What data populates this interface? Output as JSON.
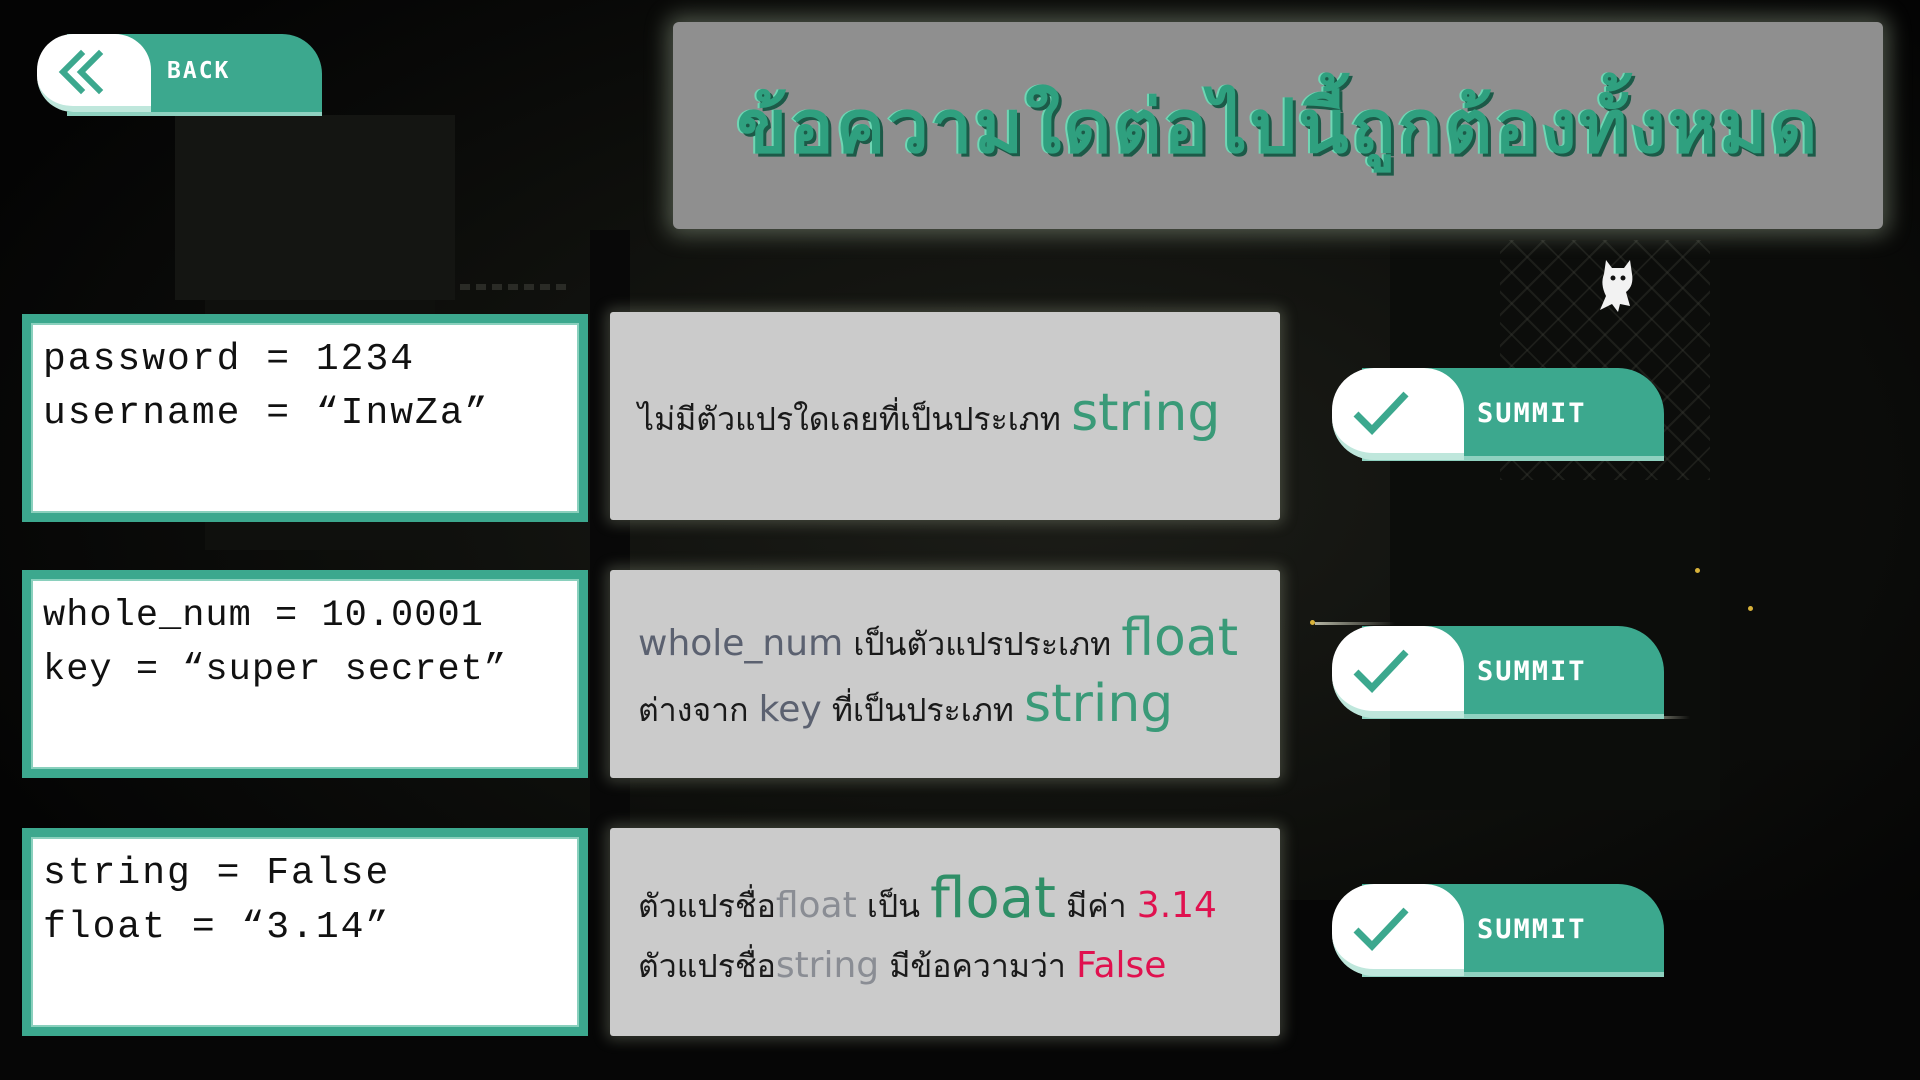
{
  "back_button": {
    "label": "BACK"
  },
  "title": "ข้อความใดต่อไปนี้ถูกต้องทั้งหมด",
  "questions": [
    {
      "code": [
        "password = 1234",
        "username = “InwZa”"
      ],
      "statement": {
        "line1": {
          "text": "ไม่มีตัวแปรใดเลยที่เป็นประเภท ",
          "type_word": "string"
        }
      },
      "submit_label": "SUMMIT"
    },
    {
      "code": [
        "whole_num = 10.0001",
        "key = “super secret”"
      ],
      "statement": {
        "line1": {
          "var": "whole_num",
          "text": " เป็นตัวแปรประเภท ",
          "type_word": "float"
        },
        "line2": {
          "text_a": "ต่างจาก ",
          "var": "key",
          "text_b": " ที่เป็นประเภท ",
          "type_word": "string"
        }
      },
      "submit_label": "SUMMIT"
    },
    {
      "code": [
        "string = False",
        "float = “3.14”"
      ],
      "statement": {
        "line1": {
          "text_a": "ตัวแปรชื่อ",
          "var": "float",
          "text_b": " เป็น ",
          "type_word": "float",
          "text_c": " มีค่า ",
          "value": "3.14"
        },
        "line2": {
          "text_a": "ตัวแปรชื่อ",
          "var": "string",
          "text_b": " มีข้อความว่า ",
          "value": "False"
        }
      },
      "submit_label": "SUMMIT"
    }
  ],
  "colors": {
    "accent": "#3ca88e",
    "panel": "#cbcbcb",
    "title_panel": "#8f8f8f",
    "type_green": "#3a9a78",
    "value_red": "#e0114f"
  },
  "icons": {
    "back": "double-chevron-left-icon",
    "submit": "checkmark-icon"
  }
}
